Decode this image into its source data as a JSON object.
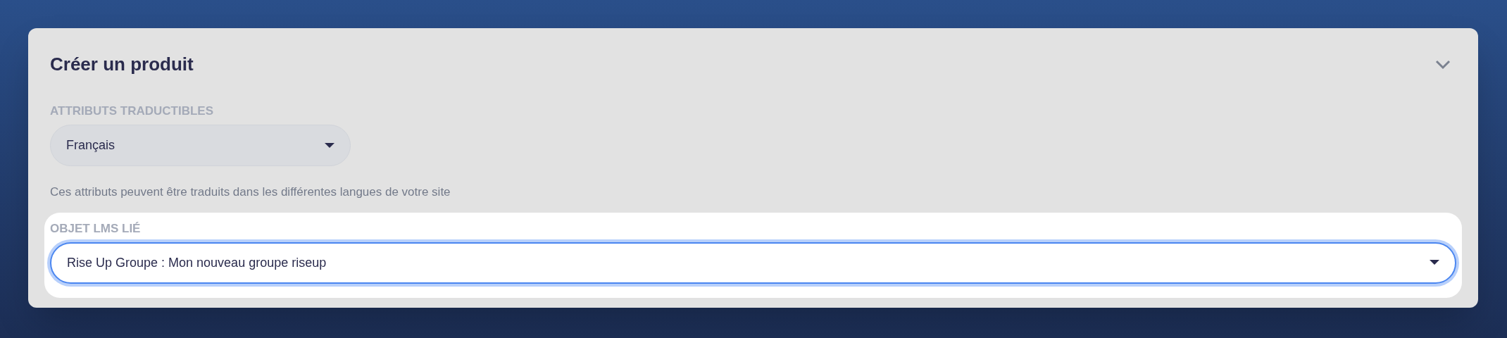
{
  "card": {
    "title": "Créer un produit"
  },
  "fields": [
    {
      "label": "ATTRIBUTS TRADUCTIBLES",
      "value": "Français",
      "help": "Ces attributs peuvent être traduits dans les différentes langues de votre site",
      "focused": false,
      "wide": false
    },
    {
      "label": "OBJET LMS LIÉ",
      "value": "Rise Up Groupe : Mon nouveau groupe riseup",
      "focused": true,
      "wide": true
    }
  ]
}
